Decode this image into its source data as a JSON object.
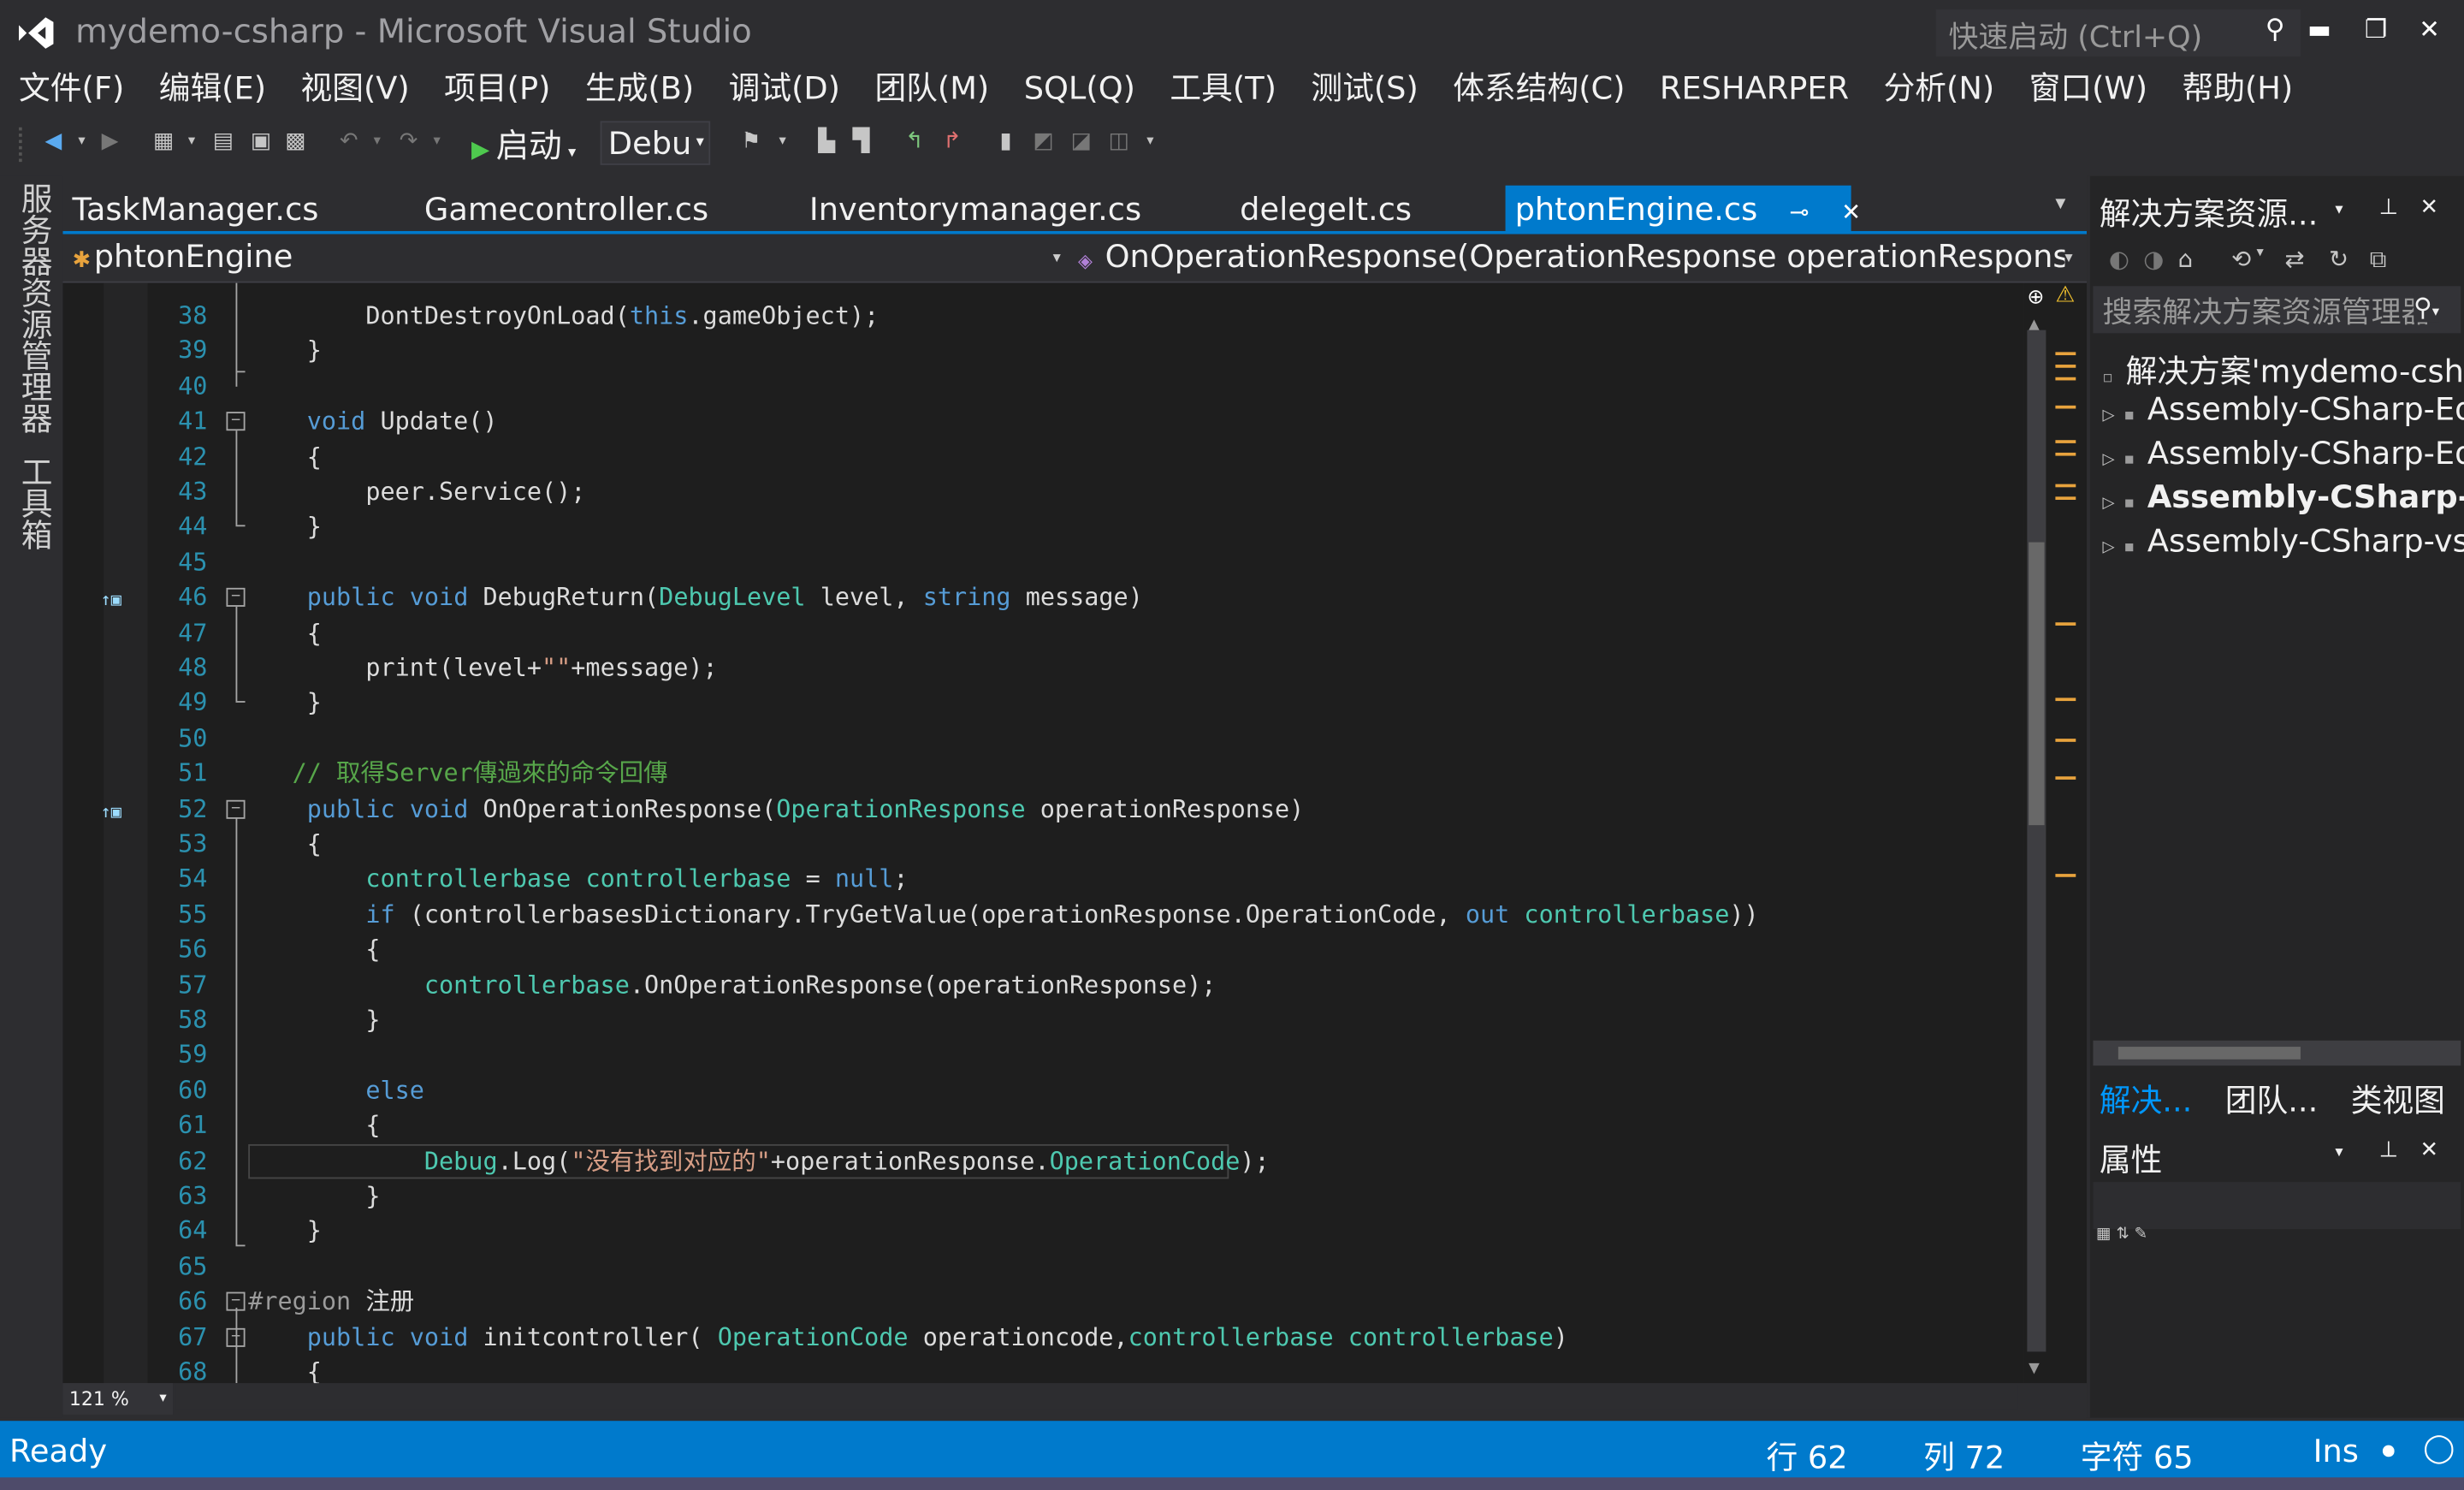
{
  "window": {
    "title": "mydemo-csharp - Microsoft Visual Studio",
    "quick_launch_placeholder": "快速启动 (Ctrl+Q)"
  },
  "menu": [
    "文件(F)",
    "编辑(E)",
    "视图(V)",
    "项目(P)",
    "生成(B)",
    "调试(D)",
    "团队(M)",
    "SQL(Q)",
    "工具(T)",
    "测试(S)",
    "体系结构(C)",
    "RESHARPER",
    "分析(N)",
    "窗口(W)",
    "帮助(H)"
  ],
  "toolbar": {
    "start_label": "启动",
    "config_value": "Debu"
  },
  "left_strip": {
    "server_explorer": "服务器资源管理器",
    "toolbox": "工具箱"
  },
  "tabs": [
    {
      "label": "TaskManager.cs"
    },
    {
      "label": "Gamecontroller.cs"
    },
    {
      "label": "Inventorymanager.cs"
    },
    {
      "label": "delegeIt.cs"
    },
    {
      "label": "phtonEngine.cs",
      "active": true
    }
  ],
  "navbar": {
    "class_name": "phtonEngine",
    "member_name": "OnOperationResponse(OperationResponse operationRespons"
  },
  "code": {
    "lines": [
      {
        "n": "38",
        "text": "        DontDestroyOnLoad(this.gameObject);"
      },
      {
        "n": "39",
        "text": "    }"
      },
      {
        "n": "40",
        "text": ""
      },
      {
        "n": "41",
        "text": "    void Update()"
      },
      {
        "n": "42",
        "text": "    {"
      },
      {
        "n": "43",
        "text": "        peer.Service();"
      },
      {
        "n": "44",
        "text": "    }"
      },
      {
        "n": "45",
        "text": ""
      },
      {
        "n": "46",
        "text": "    public void DebugReturn(DebugLevel level, string message)"
      },
      {
        "n": "47",
        "text": "    {"
      },
      {
        "n": "48",
        "text": "        print(level+\"\"+message);"
      },
      {
        "n": "49",
        "text": "    }"
      },
      {
        "n": "50",
        "text": ""
      },
      {
        "n": "51",
        "text": "   // 取得Server傳過來的命令回傳"
      },
      {
        "n": "52",
        "text": "    public void OnOperationResponse(OperationResponse operationResponse)"
      },
      {
        "n": "53",
        "text": "    {"
      },
      {
        "n": "54",
        "text": "        controllerbase controllerbase = null;"
      },
      {
        "n": "55",
        "text": "        if (controllerbasesDictionary.TryGetValue(operationResponse.OperationCode, out controllerbase))"
      },
      {
        "n": "56",
        "text": "        {"
      },
      {
        "n": "57",
        "text": "            controllerbase.OnOperationResponse(operationResponse);"
      },
      {
        "n": "58",
        "text": "        }"
      },
      {
        "n": "59",
        "text": ""
      },
      {
        "n": "60",
        "text": "        else"
      },
      {
        "n": "61",
        "text": "        {"
      },
      {
        "n": "62",
        "text": "            Debug.Log(\"没有找到对应的\"+operationResponse.OperationCode);"
      },
      {
        "n": "63",
        "text": "        }"
      },
      {
        "n": "64",
        "text": "    }"
      },
      {
        "n": "65",
        "text": ""
      },
      {
        "n": "66",
        "text": "#region 注册"
      },
      {
        "n": "67",
        "text": "    public void initcontroller( OperationCode operationcode,controllerbase controllerbase)"
      },
      {
        "n": "68",
        "text": "    {"
      }
    ]
  },
  "zoom": "121 %",
  "solution_explorer": {
    "title": "解决方案资源...",
    "search_placeholder": "搜索解决方案资源管理器",
    "items": [
      {
        "label": "解决方案'mydemo-csharp'"
      },
      {
        "label": "Assembly-CSharp-Editor"
      },
      {
        "label": "Assembly-CSharp-Editor-vs"
      },
      {
        "label": "Assembly-CSharp-vs",
        "bold": true
      },
      {
        "label": "Assembly-CSharp-vs"
      }
    ],
    "bottom_tabs": [
      "解决...",
      "团队...",
      "类视图"
    ]
  },
  "properties": {
    "title": "属性"
  },
  "status": {
    "state": "Ready",
    "line": "行 62",
    "col": "列 72",
    "char": "字符 65",
    "mode": "Ins"
  },
  "colors": {
    "accent": "#007acc",
    "background": "#2d2d30",
    "editor": "#1e1e1e"
  }
}
